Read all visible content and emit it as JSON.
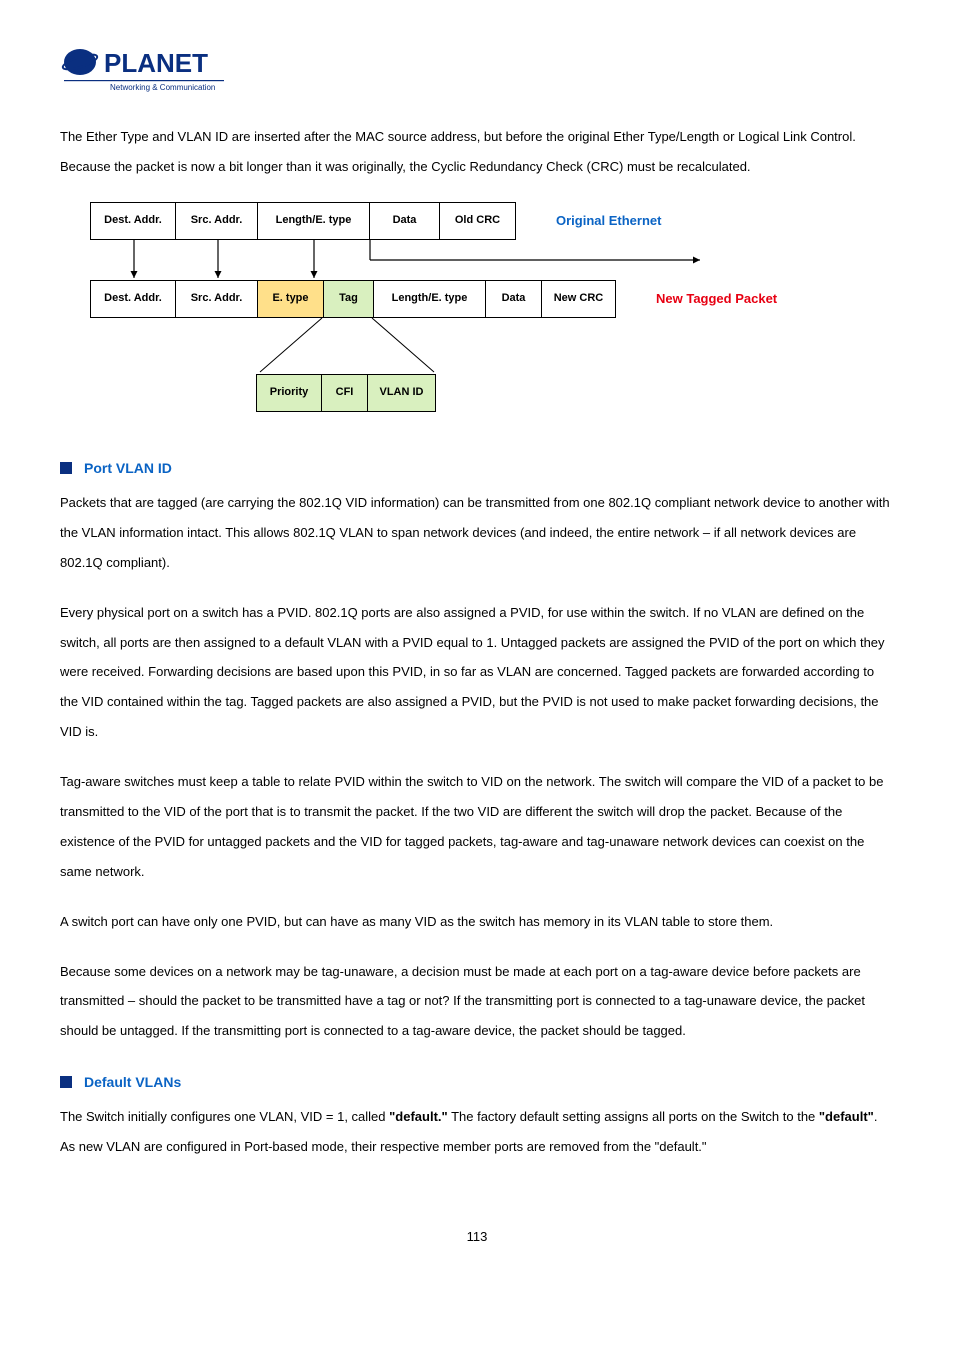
{
  "logo": {
    "tagline": "Networking & Communication"
  },
  "intro": "The Ether Type and VLAN ID are inserted after the MAC source address, but before the original Ether Type/Length or Logical Link Control. Because the packet is now a bit longer than it was originally, the Cyclic Redundancy Check (CRC) must be recalculated.",
  "diagram": {
    "row1": [
      "Dest. Addr.",
      "Src. Addr.",
      "Length/E. type",
      "Data",
      "Old CRC"
    ],
    "row1_label": "Original Ethernet",
    "row2": [
      "Dest. Addr.",
      "Src. Addr.",
      "E. type",
      "Tag",
      "Length/E. type",
      "Data",
      "New CRC"
    ],
    "row2_label": "New Tagged Packet",
    "row3": [
      "Priority",
      "CFI",
      "VLAN ID"
    ]
  },
  "sect1_title": "Port VLAN ID",
  "sect1_p1": "Packets that are tagged (are carrying the 802.1Q VID information) can be transmitted from one 802.1Q compliant network device to another with the VLAN information intact. This allows 802.1Q VLAN to span network devices (and indeed, the entire network – if all network devices are 802.1Q compliant).",
  "sect1_p2": "Every physical port on a switch has a PVID. 802.1Q ports are also assigned a PVID, for use within the switch. If no VLAN are defined on the switch, all ports are then assigned to a default VLAN with a PVID equal to 1. Untagged packets are assigned the PVID of the port on which they were received. Forwarding decisions are based upon this PVID, in so far as VLAN are concerned. Tagged packets are forwarded according to the VID contained within the tag. Tagged packets are also assigned a PVID, but the PVID is not used to make packet forwarding decisions, the VID is.",
  "sect1_p3": "Tag-aware switches must keep a table to relate PVID within the switch to VID on the network. The switch will compare the VID of a packet to be transmitted to the VID of the port that is to transmit the packet. If the two VID are different the switch will drop the packet. Because of the existence of the PVID for untagged packets and the VID for tagged packets, tag-aware and tag-unaware network devices can coexist on the same network.",
  "sect1_p4": "A switch port can have only one PVID, but can have as many VID as the switch has memory in its VLAN table to store them.",
  "sect1_p5": "Because some devices on a network may be tag-unaware, a decision must be made at each port on a tag-aware device before packets are transmitted – should the packet to be transmitted have a tag or not? If the transmitting port is connected to a tag-unaware device, the packet should be untagged. If the transmitting port is connected to a tag-aware device, the packet should be tagged.",
  "sect2_title": "Default VLANs",
  "sect2_p1_a": "The Switch initially configures one VLAN, VID = 1, called ",
  "sect2_p1_b": "\"default.\"",
  "sect2_p1_c": " The factory default setting assigns all ports on the Switch to the ",
  "sect2_p1_d": "\"default\"",
  "sect2_p1_e": ". As new VLAN are configured in Port-based mode, their respective member ports are removed from the \"default.\"",
  "page_num": "113"
}
